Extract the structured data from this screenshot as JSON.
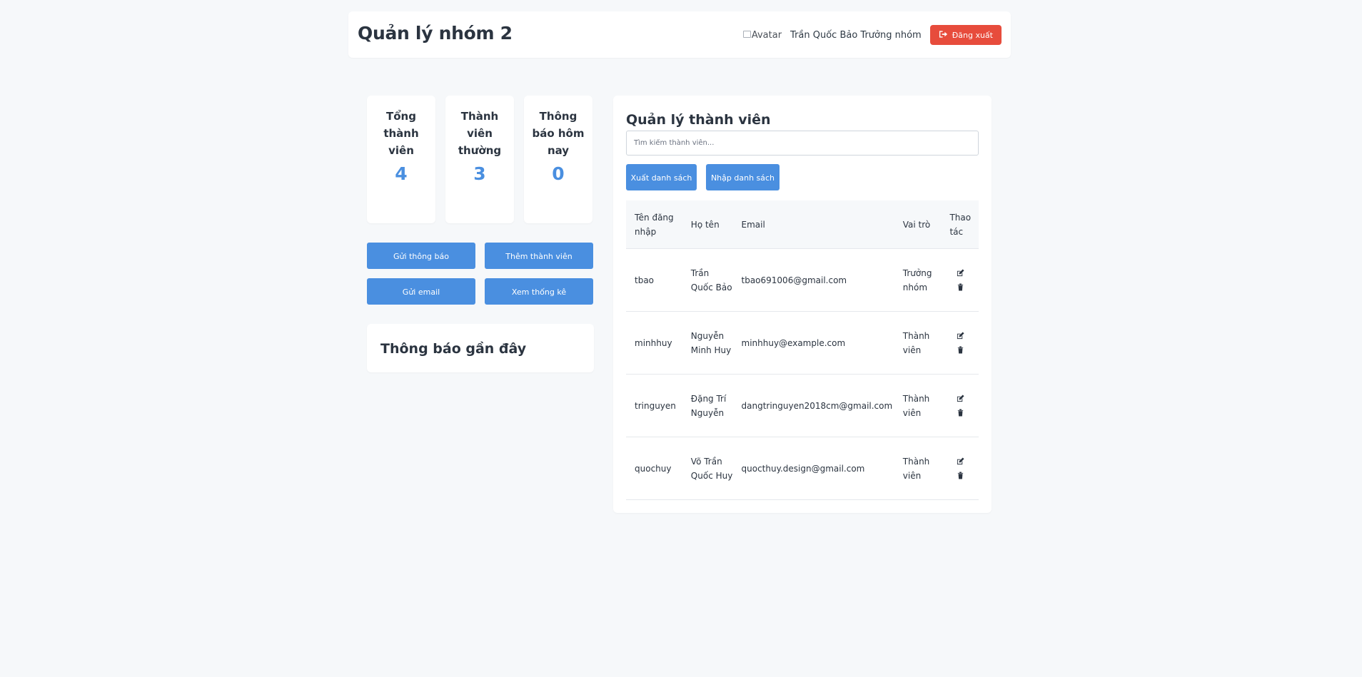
{
  "header": {
    "title": "Quản lý nhóm 2",
    "avatar_alt": "Avatar",
    "user_name": "Trần Quốc Bảo Trưởng nhóm",
    "logout_label": "Đăng xuất"
  },
  "stats": [
    {
      "label": "Tổng thành viên",
      "value": "4"
    },
    {
      "label": "Thành viên thường",
      "value": "3"
    },
    {
      "label": "Thông báo hôm nay",
      "value": "0"
    }
  ],
  "actions": {
    "send_notification": "Gửi thông báo",
    "add_member": "Thêm thành viên",
    "send_email": "Gửi email",
    "view_stats": "Xem thống kê"
  },
  "notifications": {
    "title": "Thông báo gần đây"
  },
  "members": {
    "title": "Quản lý thành viên",
    "search_placeholder": "Tìm kiếm thành viên...",
    "export_label": "Xuất danh sách",
    "import_label": "Nhập danh sách",
    "columns": [
      "Tên đăng nhập",
      "Họ tên",
      "Email",
      "Vai trò",
      "Thao tác"
    ],
    "rows": [
      {
        "username": "tbao",
        "full_name": "Trần Quốc Bảo",
        "email": "tbao691006@gmail.com",
        "role": "Trưởng nhóm"
      },
      {
        "username": "minhhuy",
        "full_name": "Nguyễn Minh Huy",
        "email": "minhhuy@example.com",
        "role": "Thành viên"
      },
      {
        "username": "tringuyen",
        "full_name": "Đặng Trí Nguyễn",
        "email": "dangtringuyen2018cm@gmail.com",
        "role": "Thành viên"
      },
      {
        "username": "quochuy",
        "full_name": "Võ Trần Quốc Huy",
        "email": "quocthuy.design@gmail.com",
        "role": "Thành viên"
      }
    ]
  },
  "icons": {
    "logout": "sign-out-icon",
    "edit": "edit-icon",
    "delete": "trash-icon"
  },
  "colors": {
    "primary": "#4a8fe0",
    "danger": "#e74c3c",
    "background": "#f6f8fa",
    "text": "#2b3440"
  }
}
